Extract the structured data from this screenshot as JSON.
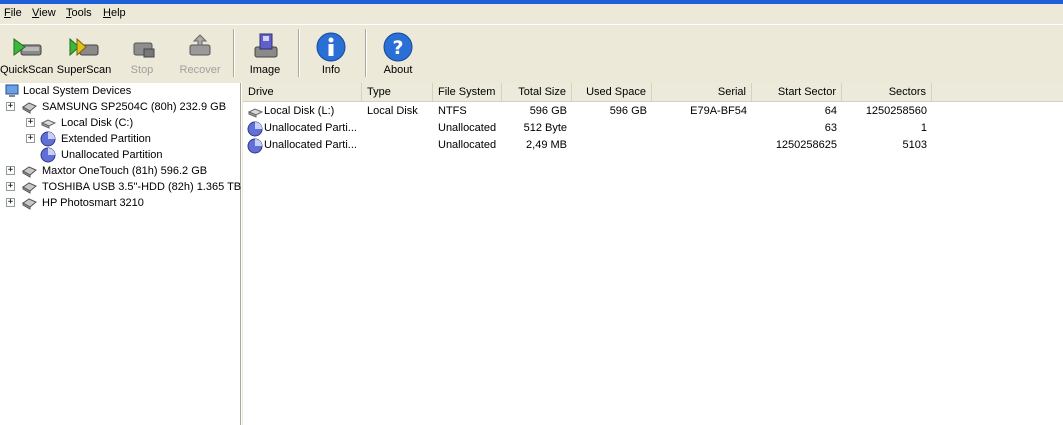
{
  "menu": [
    {
      "accel": "F",
      "rest": "ile"
    },
    {
      "accel": "V",
      "rest": "iew"
    },
    {
      "accel": "T",
      "rest": "ools"
    },
    {
      "accel": "H",
      "rest": "elp"
    }
  ],
  "toolbar": {
    "quickscan": "QuickScan",
    "superscan": "SuperScan",
    "stop": "Stop",
    "recover": "Recover",
    "image": "Image",
    "info": "Info",
    "about": "About"
  },
  "tree": {
    "root": "Local System Devices",
    "nodes": [
      {
        "label": "SAMSUNG SP2504C (80h) 232.9 GB",
        "icon": "hard-disk-icon"
      },
      {
        "label": "Local Disk (C:)",
        "icon": "volume-icon"
      },
      {
        "label": "Extended Partition",
        "icon": "partition-icon"
      },
      {
        "label": "Unallocated Partition",
        "icon": "partition-icon"
      },
      {
        "label": "Maxtor OneTouch (81h) 596.2 GB",
        "icon": "hard-disk-icon"
      },
      {
        "label": "TOSHIBA USB 3.5\"-HDD (82h) 1.365 TB",
        "icon": "hard-disk-icon"
      },
      {
        "label": "HP Photosmart 3210",
        "icon": "hard-disk-icon"
      }
    ]
  },
  "list": {
    "columns": [
      "Drive",
      "Type",
      "File System",
      "Total Size",
      "Used Space",
      "Serial",
      "Start Sector",
      "Sectors"
    ],
    "rows": [
      {
        "drive": "Local Disk (L:)",
        "type": "Local Disk",
        "fs": "NTFS",
        "total": "596 GB",
        "used": "596 GB",
        "serial": "E79A-BF54",
        "start": "64",
        "sectors": "1250258560",
        "icon": "volume-icon"
      },
      {
        "drive": "Unallocated Parti...",
        "type": "",
        "fs": "Unallocated",
        "total": "512 Byte",
        "used": "",
        "serial": "",
        "start": "63",
        "sectors": "1",
        "icon": "partition-icon"
      },
      {
        "drive": "Unallocated Parti...",
        "type": "",
        "fs": "Unallocated",
        "total": "2,49 MB",
        "used": "",
        "serial": "",
        "start": "1250258625",
        "sectors": "5103",
        "icon": "partition-icon"
      }
    ]
  },
  "colors": {
    "title_accent": "#1e5fd8",
    "window_bg": "#ece9d8",
    "info_blue": "#2a6fd6"
  }
}
